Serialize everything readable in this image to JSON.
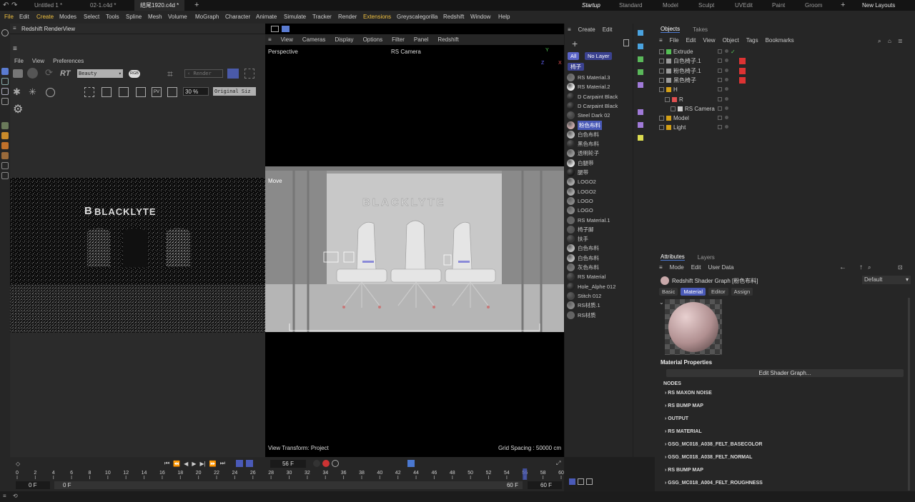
{
  "doc_tabs": [
    "Untitled 1 *",
    "02-1.c4d *",
    "结尾1920.c4d *"
  ],
  "layout_tabs": [
    "Startup",
    "Standard",
    "Model",
    "Sculpt",
    "UVEdit",
    "Paint",
    "Groom"
  ],
  "new_layouts": "New Layouts",
  "menu": [
    "File",
    "Edit",
    "Create",
    "Modes",
    "Select",
    "Tools",
    "Spline",
    "Mesh",
    "Volume",
    "MoGraph",
    "Character",
    "Animate",
    "Simulate",
    "Tracker",
    "Render",
    "Extensions",
    "Greyscalegorilla",
    "Redshift",
    "Window",
    "Help"
  ],
  "axis_labels": [
    "X",
    "Y",
    "Z"
  ],
  "renderview": {
    "title": "Redshift RenderView",
    "menu": [
      "File",
      "View",
      "Preferences"
    ],
    "rt_label": "RT",
    "aov_value": "Beauty",
    "rgb_label": "RGB",
    "render_dropdown": "Render",
    "zoom_value": "30 %",
    "size_dropdown": "Original Siz",
    "logo_text": "BLACKLYTE",
    "logo_mark": "B"
  },
  "viewport": {
    "menu": [
      "View",
      "Cameras",
      "Display",
      "Options",
      "Filter",
      "Panel",
      "Redshift"
    ],
    "perspective_label": "Perspective",
    "camera_label": "RS Camera",
    "move_label": "Move",
    "logo_text": "BLACKLYTE",
    "transform_label": "View Transform: Project",
    "grid_label": "Grid Spacing : 50000 cm",
    "axis": [
      "Y",
      "Z",
      "X"
    ]
  },
  "materials": {
    "menu": [
      "Create",
      "Edit"
    ],
    "filters": [
      "All",
      "No Layer"
    ],
    "tag": "椅子",
    "items": [
      {
        "name": "RS Material.3",
        "color": "#777777"
      },
      {
        "name": "RS Material.2",
        "color": "#eeeeee"
      },
      {
        "name": "D Carpaint Black",
        "color": "#222222"
      },
      {
        "name": "D Carpaint Black",
        "color": "#222222"
      },
      {
        "name": "Steel Dark 02",
        "color": "#444444"
      },
      {
        "name": "粉色布料",
        "color": "#c9a9aa",
        "selected": true
      },
      {
        "name": "白色布料",
        "color": "#bbbbbb"
      },
      {
        "name": "黑色布料",
        "color": "#2a2a2a"
      },
      {
        "name": "透明轮子",
        "color": "#999999"
      },
      {
        "name": "白腿带",
        "color": "#dddddd"
      },
      {
        "name": "腿带",
        "color": "#1a1a1a"
      },
      {
        "name": "LOGO2",
        "color": "#aaaaaa"
      },
      {
        "name": "LOGO2",
        "color": "#aaaaaa"
      },
      {
        "name": "LOGO",
        "color": "#888888"
      },
      {
        "name": "LOGO",
        "color": "#888888"
      },
      {
        "name": "RS Material.1",
        "color": "#666666"
      },
      {
        "name": "椅子脚",
        "color": "#555555"
      },
      {
        "name": "扶手",
        "color": "#333333"
      },
      {
        "name": "白色布料",
        "color": "#bbbbbb"
      },
      {
        "name": "白色布料",
        "color": "#bbbbbb"
      },
      {
        "name": "灰色布料",
        "color": "#777777"
      },
      {
        "name": "RS Material",
        "color": "#333333"
      },
      {
        "name": "Hole_Alphe 012",
        "color": "#222222"
      },
      {
        "name": "Stitch 012",
        "color": "#444444"
      },
      {
        "name": "RS材质.1",
        "color": "#888888"
      },
      {
        "name": "RS材质",
        "color": "#666666"
      }
    ]
  },
  "objects": {
    "tabs": [
      "Objects",
      "Takes"
    ],
    "menu": [
      "File",
      "Edit",
      "View",
      "Object",
      "Tags",
      "Bookmarks"
    ],
    "items": [
      {
        "name": "Extrude",
        "depth": 0,
        "icon_color": "#55c055",
        "check": true
      },
      {
        "name": "白色椅子.1",
        "depth": 0,
        "icon_color": "#9a9a9a",
        "tag": "#dd3333"
      },
      {
        "name": "粉色椅子.1",
        "depth": 0,
        "icon_color": "#9a9a9a",
        "tag": "#dd3333"
      },
      {
        "name": "黑色椅子",
        "depth": 0,
        "icon_color": "#9a9a9a",
        "tag": "#dd3333"
      },
      {
        "name": "H",
        "depth": 0,
        "icon_color": "#d4a017"
      },
      {
        "name": "R",
        "depth": 1,
        "icon_color": "#e05050"
      },
      {
        "name": "RS Camera",
        "depth": 2,
        "icon_color": "#cccccc"
      },
      {
        "name": "Model",
        "depth": 0,
        "icon_color": "#d4a017"
      },
      {
        "name": "Light",
        "depth": 0,
        "icon_color": "#d4a017"
      }
    ]
  },
  "attributes": {
    "tabs": [
      "Attributes",
      "Layers"
    ],
    "menu": [
      "Mode",
      "Edit",
      "User Data"
    ],
    "object_title": "Redshift Shader Graph [粉色布料]",
    "preset": "Default",
    "subtabs": [
      "Basic",
      "Material",
      "Editor",
      "Assign"
    ],
    "section_title": "Material Properties",
    "edit_button": "Edit Shader Graph...",
    "nodes_header": "NODES",
    "nodes": [
      "RS MAXON NOISE",
      "RS BUMP MAP",
      "OUTPUT",
      "RS MATERIAL",
      "GSG_MC018_A038_FELT_BASECOLOR",
      "GSG_MC018_A038_FELT_NORMAL",
      "RS BUMP MAP",
      "GSG_MC018_A004_FELT_ROUGHNESS"
    ]
  },
  "timeline": {
    "current_frame": "56 F",
    "ticks": [
      "0",
      "2",
      "4",
      "6",
      "8",
      "10",
      "12",
      "14",
      "16",
      "18",
      "20",
      "22",
      "24",
      "26",
      "28",
      "30",
      "32",
      "34",
      "36",
      "38",
      "40",
      "42",
      "44",
      "46",
      "48",
      "50",
      "52",
      "54",
      "56",
      "58",
      "60"
    ],
    "start_a": "0 F",
    "start_b": "0 F",
    "end_a": "60 F",
    "end_b": "60 F",
    "playhead_fraction": 0.9333
  }
}
